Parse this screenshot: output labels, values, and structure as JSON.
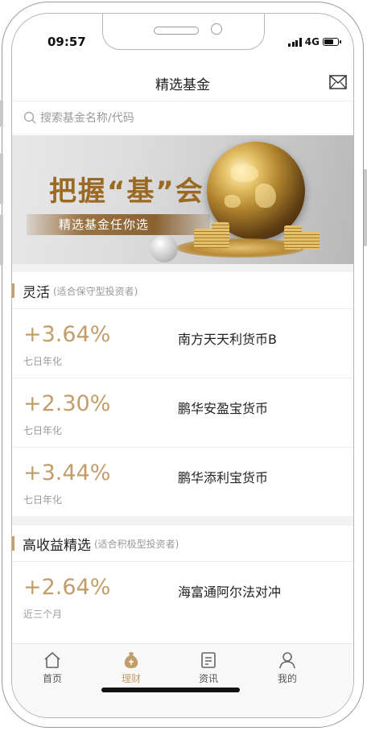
{
  "statusbar": {
    "time": "09:57",
    "network": "4G"
  },
  "navbar": {
    "title": "精选基金",
    "mail_icon": "mail-icon"
  },
  "search": {
    "placeholder": "搜索基金名称/代码"
  },
  "banner": {
    "title": "把握“基”会",
    "subtitle": "精选基金任你选"
  },
  "sections": [
    {
      "title": "灵活",
      "note": "(适合保守型投资者)",
      "funds": [
        {
          "rate": "+3.64%",
          "rate_label": "七日年化",
          "name": "南方天天利货币B"
        },
        {
          "rate": "+2.30%",
          "rate_label": "七日年化",
          "name": "鹏华安盈宝货币"
        },
        {
          "rate": "+3.44%",
          "rate_label": "七日年化",
          "name": "鹏华添利宝货币"
        }
      ]
    },
    {
      "title": "高收益精选",
      "note": "(适合积极型投资者)",
      "funds": [
        {
          "rate": "+2.64%",
          "rate_label": "近三个月",
          "name": "海富通阿尔法对冲"
        }
      ]
    }
  ],
  "tabbar": {
    "tabs": [
      {
        "label": "首页",
        "icon": "home-icon",
        "active": false
      },
      {
        "label": "理财",
        "icon": "wealth-icon",
        "active": true
      },
      {
        "label": "资讯",
        "icon": "news-icon",
        "active": false
      },
      {
        "label": "我的",
        "icon": "profile-icon",
        "active": false
      }
    ]
  },
  "colors": {
    "accent": "#c29d6a",
    "text": "#222222",
    "muted": "#999999"
  }
}
